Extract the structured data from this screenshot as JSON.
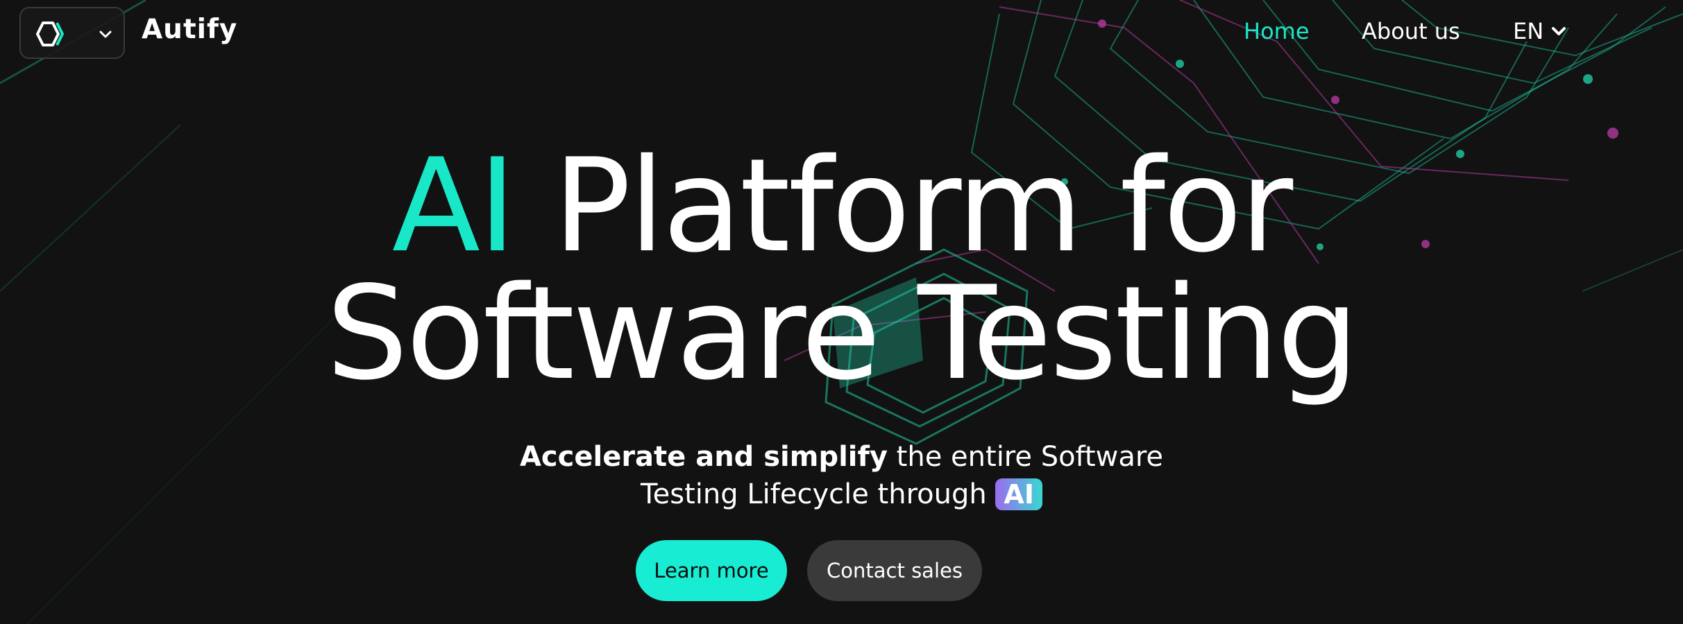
{
  "colors": {
    "background": "#121212",
    "accent": "#18e8c8",
    "button_primary": "#18ecd2",
    "button_secondary": "#3a3a3a",
    "ai_chip_gradient_start": "#9b6cf0",
    "ai_chip_gradient_end": "#3ad7d0",
    "decor_green": "#1fc9a3",
    "decor_magenta": "#b03a9e"
  },
  "header": {
    "brand": "Autify",
    "logo_icon": "autify-logo-icon",
    "switcher_icon": "chevron-down-icon",
    "nav": {
      "home": "Home",
      "about": "About us"
    },
    "language": {
      "current": "EN",
      "icon": "chevron-down-icon"
    }
  },
  "hero": {
    "title_accent": "AI",
    "title_rest_line1": " Platform for",
    "title_line2": "Software Testing",
    "subtitle_bold": "Accelerate and simplify",
    "subtitle_rest_line1": " the entire Software",
    "subtitle_line2": "Testing Lifecycle through ",
    "subtitle_chip": "AI"
  },
  "cta": {
    "primary": "Learn more",
    "secondary": "Contact sales"
  }
}
